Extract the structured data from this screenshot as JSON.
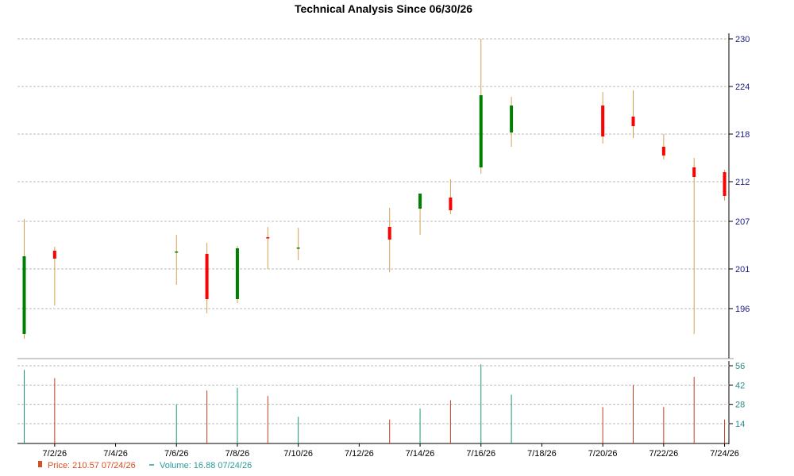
{
  "chart_data": {
    "type": "candlestick",
    "title": "Technical Analysis Since 06/30/26",
    "colors": {
      "up": "#008000",
      "down": "#ff0000",
      "wick": "#d4a050",
      "grid": "#bbbbbb",
      "price_axis_text": "#1a1a80",
      "volume_axis_text": "#2b8a8a",
      "volume_up": "#1a9a6a",
      "volume_down": "#c04020"
    },
    "price_axis": {
      "ticks": [
        196,
        201,
        207,
        212,
        218,
        224,
        230
      ],
      "range": [
        191.5,
        231
      ],
      "side": "right"
    },
    "volume_axis": {
      "ticks": [
        14,
        28,
        42,
        56
      ],
      "range": [
        0,
        58
      ],
      "side": "right"
    },
    "x_axis": {
      "ticks": [
        "7/2/26",
        "7/4/26",
        "7/6/26",
        "7/8/26",
        "7/10/26",
        "7/12/26",
        "7/14/26",
        "7/16/26",
        "7/18/26",
        "7/20/26",
        "7/22/26",
        "7/24/26"
      ]
    },
    "candles": [
      {
        "date": "7/1/26",
        "open": 192.8,
        "high": 207.3,
        "low": 192.2,
        "close": 202.6,
        "volume": 53
      },
      {
        "date": "7/2/26",
        "open": 203.3,
        "high": 203.8,
        "low": 196.4,
        "close": 202.3,
        "volume": 47
      },
      {
        "date": "7/6/26",
        "open": 203.2,
        "high": 205.3,
        "low": 199.0,
        "close": 203.2,
        "volume": 28
      },
      {
        "date": "7/7/26",
        "open": 202.9,
        "high": 204.3,
        "low": 195.4,
        "close": 197.2,
        "volume": 38
      },
      {
        "date": "7/8/26",
        "open": 197.2,
        "high": 203.9,
        "low": 196.7,
        "close": 203.6,
        "volume": 40
      },
      {
        "date": "7/9/26",
        "open": 205.0,
        "high": 206.3,
        "low": 201.0,
        "close": 204.9,
        "volume": 34
      },
      {
        "date": "7/10/26",
        "open": 203.7,
        "high": 206.2,
        "low": 202.1,
        "close": 203.7,
        "volume": 19
      },
      {
        "date": "7/13/26",
        "open": 206.3,
        "high": 208.7,
        "low": 200.6,
        "close": 204.7,
        "volume": 17
      },
      {
        "date": "7/14/26",
        "open": 208.6,
        "high": 210.4,
        "low": 205.3,
        "close": 210.5,
        "volume": 25
      },
      {
        "date": "7/15/26",
        "open": 210.0,
        "high": 212.3,
        "low": 207.9,
        "close": 208.4,
        "volume": 31
      },
      {
        "date": "7/16/26",
        "open": 213.8,
        "high": 230.0,
        "low": 213.0,
        "close": 222.9,
        "volume": 57
      },
      {
        "date": "7/17/26",
        "open": 218.2,
        "high": 222.7,
        "low": 216.4,
        "close": 221.6,
        "volume": 35
      },
      {
        "date": "7/20/26",
        "open": 221.6,
        "high": 223.3,
        "low": 216.8,
        "close": 217.7,
        "volume": 26
      },
      {
        "date": "7/21/26",
        "open": 220.2,
        "high": 223.5,
        "low": 217.5,
        "close": 219.0,
        "volume": 42
      },
      {
        "date": "7/22/26",
        "open": 216.4,
        "high": 218.0,
        "low": 214.8,
        "close": 215.3,
        "volume": 26
      },
      {
        "date": "7/23/26",
        "open": 213.8,
        "high": 215.0,
        "low": 192.8,
        "close": 212.6,
        "volume": 48
      },
      {
        "date": "7/24/26",
        "open": 213.2,
        "high": 213.5,
        "low": 209.6,
        "close": 210.2,
        "volume": 17
      }
    ],
    "legend": {
      "price_label": "Price: 210.57  07/24/26",
      "volume_label": "Volume: 16.88  07/24/26"
    }
  }
}
